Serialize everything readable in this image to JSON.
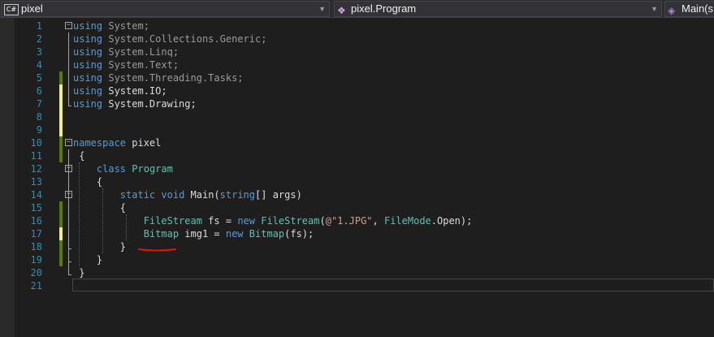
{
  "navbar": {
    "project_badge": "C#",
    "project": "pixel",
    "class": "pixel.Program",
    "member": "Main(s"
  },
  "editor": {
    "lines": [
      {
        "num": "1",
        "tokens": [
          {
            "c": "kw",
            "t": "using"
          },
          {
            "c": "dim",
            "t": " System;"
          }
        ]
      },
      {
        "num": "2",
        "tokens": [
          {
            "c": "kw",
            "t": "using"
          },
          {
            "c": "dim",
            "t": " System.Collections.Generic;"
          }
        ]
      },
      {
        "num": "3",
        "tokens": [
          {
            "c": "kw",
            "t": "using"
          },
          {
            "c": "dim",
            "t": " System.Linq;"
          }
        ]
      },
      {
        "num": "4",
        "tokens": [
          {
            "c": "kw",
            "t": "using"
          },
          {
            "c": "dim",
            "t": " System.Text;"
          }
        ]
      },
      {
        "num": "5",
        "tokens": [
          {
            "c": "kw",
            "t": "using"
          },
          {
            "c": "dim",
            "t": " System.Threading.Tasks;"
          }
        ]
      },
      {
        "num": "6",
        "tokens": [
          {
            "c": "kw",
            "t": "using"
          },
          {
            "c": "pl",
            "t": " System.IO;"
          }
        ]
      },
      {
        "num": "7",
        "tokens": [
          {
            "c": "kw",
            "t": "using"
          },
          {
            "c": "pl",
            "t": " System.Drawing;"
          }
        ]
      },
      {
        "num": "8",
        "tokens": []
      },
      {
        "num": "9",
        "tokens": []
      },
      {
        "num": "10",
        "tokens": [
          {
            "c": "kw",
            "t": "namespace"
          },
          {
            "c": "pl",
            "t": " pixel"
          }
        ]
      },
      {
        "num": "11",
        "tokens": [
          {
            "c": "pl",
            "t": " {"
          }
        ]
      },
      {
        "num": "12",
        "tokens": [
          {
            "c": "pl",
            "t": "    "
          },
          {
            "c": "kw",
            "t": "class"
          },
          {
            "c": "pl",
            "t": " "
          },
          {
            "c": "ty",
            "t": "Program"
          }
        ]
      },
      {
        "num": "13",
        "tokens": [
          {
            "c": "pl",
            "t": "    {"
          }
        ]
      },
      {
        "num": "14",
        "tokens": [
          {
            "c": "pl",
            "t": "        "
          },
          {
            "c": "kw",
            "t": "static"
          },
          {
            "c": "pl",
            "t": " "
          },
          {
            "c": "kw",
            "t": "void"
          },
          {
            "c": "pl",
            "t": " Main("
          },
          {
            "c": "kw",
            "t": "string"
          },
          {
            "c": "pl",
            "t": "[] args)"
          }
        ]
      },
      {
        "num": "15",
        "tokens": [
          {
            "c": "pl",
            "t": "        {"
          }
        ]
      },
      {
        "num": "16",
        "tokens": [
          {
            "c": "pl",
            "t": "            "
          },
          {
            "c": "ty",
            "t": "FileStream"
          },
          {
            "c": "pl",
            "t": " fs = "
          },
          {
            "c": "kw",
            "t": "new"
          },
          {
            "c": "pl",
            "t": " "
          },
          {
            "c": "ty",
            "t": "FileStream"
          },
          {
            "c": "pl",
            "t": "("
          },
          {
            "c": "st",
            "t": "@\"1.JPG\""
          },
          {
            "c": "pl",
            "t": ", "
          },
          {
            "c": "ty",
            "t": "FileMode"
          },
          {
            "c": "pl",
            "t": ".Open);"
          }
        ]
      },
      {
        "num": "17",
        "tokens": [
          {
            "c": "pl",
            "t": "            "
          },
          {
            "c": "ty",
            "t": "Bitmap"
          },
          {
            "c": "pl",
            "t": " img1 = "
          },
          {
            "c": "kw",
            "t": "new"
          },
          {
            "c": "pl",
            "t": " "
          },
          {
            "c": "ty",
            "t": "Bitmap"
          },
          {
            "c": "pl",
            "t": "(fs);"
          }
        ]
      },
      {
        "num": "18",
        "tokens": [
          {
            "c": "pl",
            "t": "        }"
          }
        ]
      },
      {
        "num": "19",
        "tokens": [
          {
            "c": "pl",
            "t": "    }"
          }
        ]
      },
      {
        "num": "20",
        "tokens": [
          {
            "c": "pl",
            "t": " }"
          }
        ]
      },
      {
        "num": "21",
        "tokens": []
      }
    ],
    "change_marks": [
      "",
      "",
      "",
      "",
      "saved",
      "unsaved",
      "unsaved",
      "unsaved",
      "unsaved",
      "saved",
      "saved",
      "",
      "",
      "",
      "saved",
      "saved",
      "unsaved",
      "saved",
      "saved",
      "",
      ""
    ],
    "colors": {
      "background": "#1e1e1e",
      "keyword": "#569cd6",
      "type": "#4ec9b0",
      "string": "#d69d85",
      "line_number": "#2b91af",
      "annotation_underline": "#e51400"
    }
  }
}
